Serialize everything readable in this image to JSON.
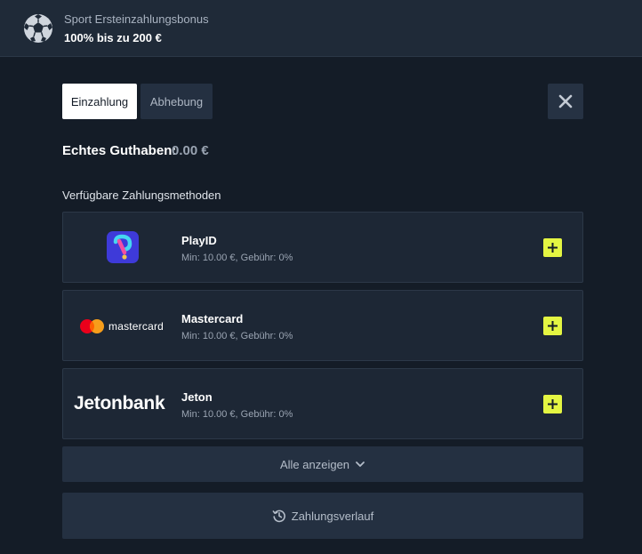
{
  "banner": {
    "subtitle": "Sport Ersteinzahlungsbonus",
    "title": "100% bis zu 200 €"
  },
  "tabs": [
    {
      "label": "Einzahlung",
      "active": true
    },
    {
      "label": "Abhebung",
      "active": false
    }
  ],
  "balance": {
    "label": "Echtes Guthaben:",
    "value": "0.00 €"
  },
  "methods_title": "Verfügbare Zahlungsmethoden",
  "methods": [
    {
      "name": "PlayID",
      "info": "Min: 10.00 €, Gebühr: 0%",
      "logo": "playid-logo"
    },
    {
      "name": "Mastercard",
      "info": "Min: 10.00 €, Gebühr: 0%",
      "logo": "mastercard-logo",
      "logo_text": "mastercard"
    },
    {
      "name": "Jeton",
      "info": "Min: 10.00 €, Gebühr: 0%",
      "logo": "jetonbank-logo",
      "logo_text": "Jetonbank"
    }
  ],
  "show_all_label": "Alle anzeigen",
  "history_label": "Zahlungsverlauf",
  "colors": {
    "accent": "#e4f542",
    "background": "#141c27",
    "card": "#1d2735"
  }
}
